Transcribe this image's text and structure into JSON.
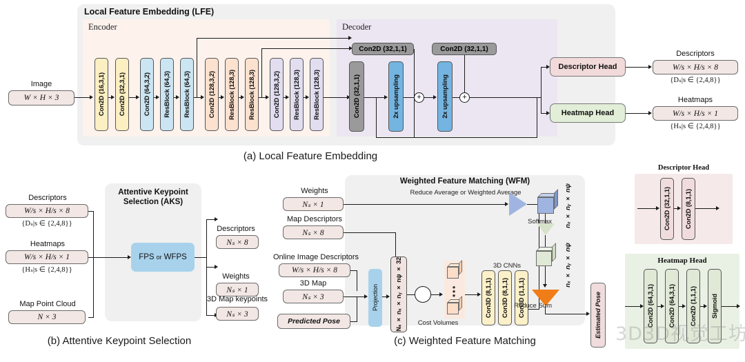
{
  "figure": {
    "captions": {
      "a": "(a) Local Feature Embedding",
      "b": "(b) Attentive Keypoint Selection",
      "c": "(c) Weighted Feature Matching"
    },
    "watermark": "3D视觉工坊"
  },
  "lfe": {
    "title": "Local Feature Embedding (LFE)",
    "encoder_label": "Encoder",
    "decoder_label": "Decoder",
    "input": {
      "label": "Image",
      "shape": "W × H × 3"
    },
    "encoder_blocks": [
      {
        "label": "Con2D (16,3,1)",
        "color": "yellow"
      },
      {
        "label": "Con2D (32,3,1)",
        "color": "yellow"
      },
      {
        "label": "Con2D (64,3,2)",
        "color": "blue"
      },
      {
        "label": "ResBlock (64,3)",
        "color": "blue"
      },
      {
        "label": "ResBlock (64,3)",
        "color": "blue"
      },
      {
        "label": "Con2D (128,3,2)",
        "color": "peach"
      },
      {
        "label": "ResBlock (128,3)",
        "color": "peach"
      },
      {
        "label": "ResBlock (128,3)",
        "color": "peach"
      },
      {
        "label": "Con2D (128,3,2)",
        "color": "lav"
      },
      {
        "label": "ResBlock (128,3)",
        "color": "lav"
      },
      {
        "label": "ResBlock (128,3)",
        "color": "lav"
      }
    ],
    "decoder_skip_convs": [
      {
        "label": "Con2D (32,1,1)"
      },
      {
        "label": "Con2D (32,1,1)"
      }
    ],
    "decoder_blocks": [
      {
        "label": "Con2D (32,1,1)",
        "color": "gray"
      },
      {
        "label": "2x upsampling",
        "color": "skyblue"
      },
      {
        "label": "2x upsampling",
        "color": "skyblue"
      }
    ],
    "merge_symbol": "+",
    "heads": [
      {
        "label": "Descriptor Head",
        "color": "#f2dada"
      },
      {
        "label": "Heatmap Head",
        "color": "#e2eed7"
      }
    ],
    "outputs": [
      {
        "title": "Descriptors",
        "shape": "W/s × H/s × 8",
        "set": "{Dₛ|s ∈ {2,4,8}}"
      },
      {
        "title": "Heatmaps",
        "shape": "W/s × H/s × 1",
        "set": "{Hₛ|s ∈ {2,4,8}}"
      }
    ]
  },
  "aks": {
    "title_line1": "Attentive Keypoint",
    "title_line2": "Selection (AKS)",
    "core_label": "FPS or WFPS",
    "core_label_parts": {
      "a": "FPS",
      "or": "or",
      "b": "WFPS"
    },
    "inputs": [
      {
        "title": "Descriptors",
        "shape": "W/s × H/s × 8",
        "set": "{Dₛ|s ∈ {2,4,8}}"
      },
      {
        "title": "Heatmaps",
        "shape": "W/s × H/s × 1",
        "set": "{Hₛ|s ∈ {2,4,8}}"
      },
      {
        "title": "Map Point Cloud",
        "shape": "N × 3",
        "set": ""
      }
    ],
    "outputs": [
      {
        "title": "Descriptors",
        "shape": "Nₛ × 8"
      },
      {
        "title": "Weights",
        "shape": "Nₛ × 1"
      },
      {
        "title": "3D Map keypoints",
        "shape": "Nₛ × 3"
      }
    ]
  },
  "wfm": {
    "title": "Weighted Feature Matching (WFM)",
    "reduce_label": "Reduce Average or Weighted Average",
    "inputs": [
      {
        "title": "Weights",
        "shape": "Nₛ × 1",
        "italic": true
      },
      {
        "title": "Map Descriptors",
        "shape": "Nₛ × 8",
        "italic": true
      },
      {
        "title": "Online Image Descriptors",
        "shape": "W/s × H/s × 8",
        "italic": true
      },
      {
        "title": "3D Map",
        "shape": "Nₛ × 3",
        "italic": true
      },
      {
        "title": "",
        "shape": "Predicted Pose",
        "italic": true
      }
    ],
    "projection_label": "Projection",
    "tensor_label": "Nₛ × nₓ × nᵧ × nψ × 32",
    "cost_volumes_label": "Cost Volumes",
    "cnn_group_label": "3D CNNs",
    "cnn_blocks": [
      {
        "label": "Con3D (8,1,1)"
      },
      {
        "label": "Con3D (8,1,1)"
      },
      {
        "label": "Con3D (1,1,1)"
      }
    ],
    "softmax_label": "Softmax",
    "reduce_sum_label": "Reduce Sum",
    "volume_dim_label_top": "nₓ × nᵧ × nψ",
    "volume_dim_label_bottom": "nₓ × nᵧ × nψ",
    "estimated_pose_label": "Estimated Pose"
  },
  "descriptor_head": {
    "title": "Descriptor Head",
    "blocks": [
      {
        "label": "Con2D (32,1,1)"
      },
      {
        "label": "Con2D (8,1,1)"
      }
    ]
  },
  "heatmap_head": {
    "title": "Heatmap Head",
    "blocks": [
      {
        "label": "Con2D (64,3,1)"
      },
      {
        "label": "Con2D (64,3,1)"
      },
      {
        "label": "Con2D (1,1,1)"
      },
      {
        "label": "Sigmoid"
      }
    ]
  }
}
